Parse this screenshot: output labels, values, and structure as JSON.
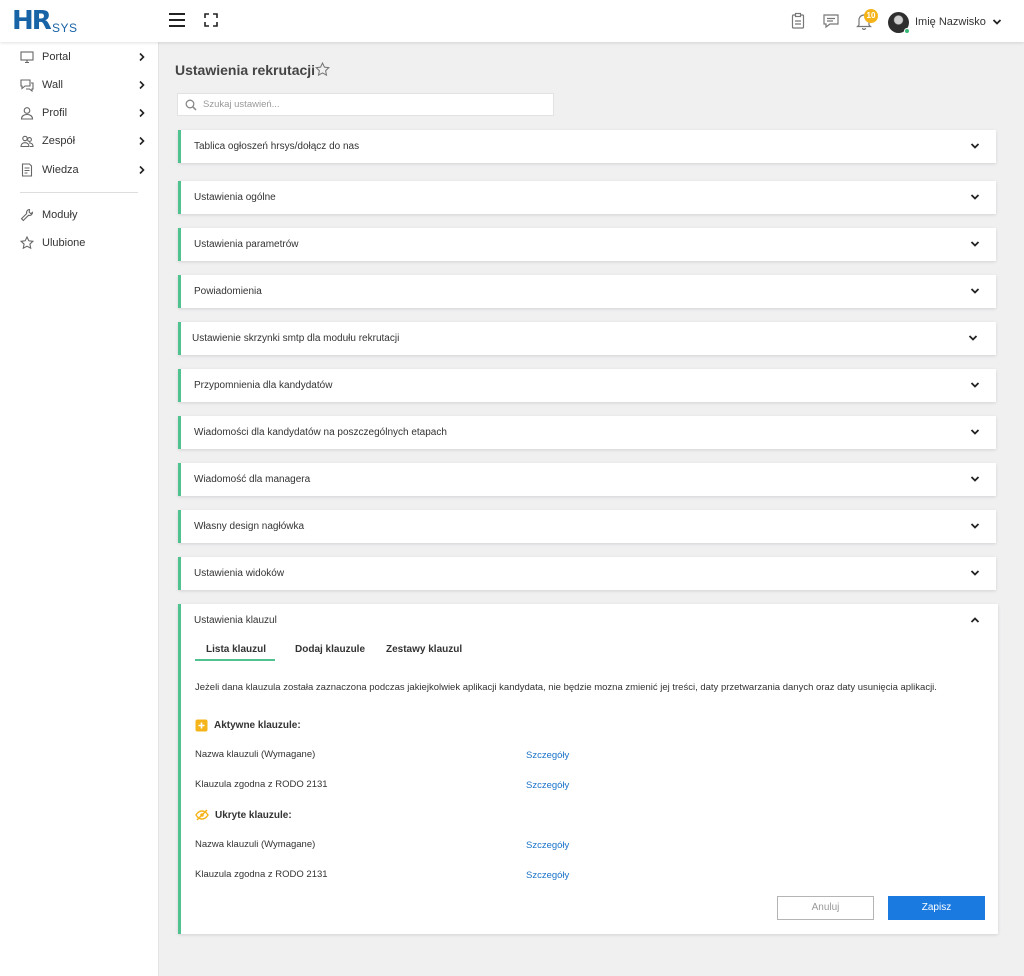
{
  "topbar": {
    "logo_main": "HR",
    "logo_sub": "SYS",
    "notification_count": "10",
    "user_name": "Imię Nazwisko",
    "icons": [
      "menu-icon",
      "fullscreen-icon",
      "clipboard-icon",
      "chat-icon",
      "bell-icon",
      "chevron-down-icon"
    ]
  },
  "sidebar": {
    "items": [
      {
        "label": "Portal",
        "icon": "monitor-icon"
      },
      {
        "label": "Wall",
        "icon": "chat-icon"
      },
      {
        "label": "Profil",
        "icon": "user-icon"
      },
      {
        "label": "Zespół",
        "icon": "team-icon"
      },
      {
        "label": "Wiedza",
        "icon": "document-icon"
      },
      {
        "label": "Moduły",
        "icon": "wrench-icon"
      },
      {
        "label": "Ulubione",
        "icon": "star-icon"
      }
    ]
  },
  "page": {
    "title": "Ustawienia rekrutacji",
    "search_placeholder": "Szukaj ustawień..."
  },
  "sections": [
    "Tablica ogłoszeń hrsys/dołącz do nas",
    "Ustawienia ogólne",
    "Ustawienia parametrów",
    "Powiadomienia",
    "Ustawienie skrzynki smtp dla modułu rekrutacji",
    "Przypomnienia dla kandydatów",
    "Wiadomości dla kandydatów na poszczególnych etapach",
    "Wiadomość dla managera",
    "Własny design nagłówka",
    "Ustawienia widoków"
  ],
  "expanded": {
    "title": "Ustawienia klauzul",
    "tabs": [
      "Lista klauzul",
      "Dodaj klauzule",
      "Zestawy klauzul"
    ],
    "active_tab": "Lista klauzul",
    "info": "Jeżeli dana klauzula została zaznaczona podczas jakiejkolwiek aplikacji kandydata, nie będzie mozna zmienić jej treści, daty przetwarzania danych oraz daty usunięcia aplikacji.",
    "active_heading": "Aktywne klauzule:",
    "active_rows": [
      {
        "name": "Nazwa klauzuli (Wymagane)",
        "link": "Szczegóły"
      },
      {
        "name": "Klauzula zgodna z RODO 2131",
        "link": "Szczegóły"
      }
    ],
    "hidden_heading": "Ukryte klauzule:",
    "hidden_rows": [
      {
        "name": "Nazwa klauzuli (Wymagane)",
        "link": "Szczegóły"
      },
      {
        "name": "Klauzula zgodna z RODO 2131",
        "link": "Szczegóły"
      }
    ],
    "cancel_label": "Anuluj",
    "save_label": "Zapisz"
  },
  "colors": {
    "accent_green": "#4fc28f",
    "brand_blue": "#1763a6",
    "primary_button": "#1a7ae0",
    "link": "#1a73c8",
    "badge": "#f6b41b"
  }
}
